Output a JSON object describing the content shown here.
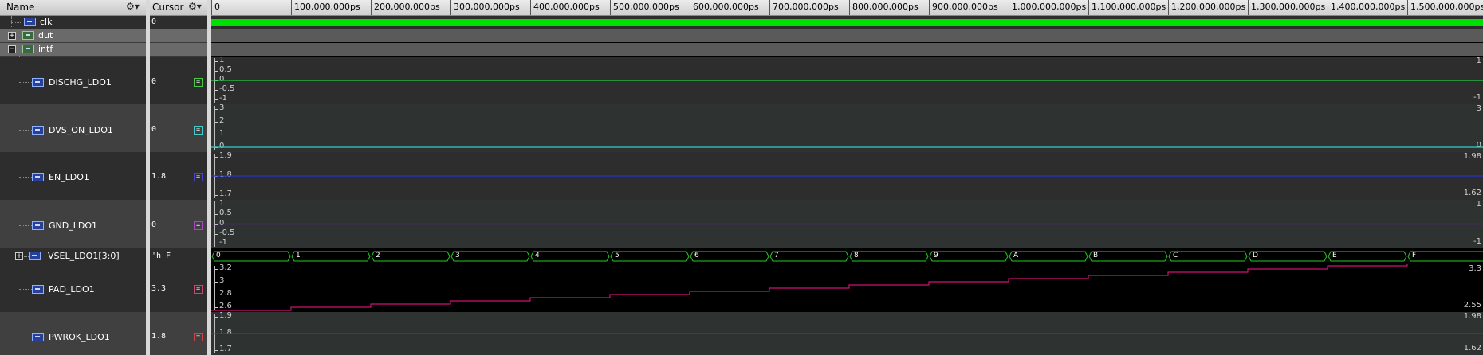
{
  "names_panel": {
    "title": "Name",
    "rows": [
      {
        "label": "clk"
      },
      {
        "label": "dut"
      },
      {
        "label": "intf"
      },
      {
        "label": "DISCHG_LDO1"
      },
      {
        "label": "DVS_ON_LDO1"
      },
      {
        "label": "EN_LDO1"
      },
      {
        "label": "GND_LDO1"
      },
      {
        "label": "VSEL_LDO1[3:0]"
      },
      {
        "label": "PAD_LDO1"
      },
      {
        "label": "PWROK_LDO1"
      }
    ]
  },
  "values_panel": {
    "title": "Cursor",
    "values": [
      "0",
      "",
      "",
      "0",
      "0",
      "1.8",
      "0",
      "'h F",
      "3.3",
      "1.8"
    ]
  },
  "ruler": {
    "labels": [
      "0",
      "100,000,000ps",
      "200,000,000ps",
      "300,000,000ps",
      "400,000,000ps",
      "500,000,000ps",
      "600,000,000ps",
      "700,000,000ps",
      "800,000,000ps",
      "900,000,000ps",
      "1,000,000,000ps",
      "1,100,000,000ps",
      "1,200,000,000ps",
      "1,300,000,000ps",
      "1,400,000,000ps",
      "1,500,000,000ps"
    ]
  },
  "waves": {
    "DISCHG_LDO1": {
      "ticks": [
        "1",
        "0.5",
        "0",
        "-0.5",
        "-1"
      ],
      "top": "1",
      "bottom": "-1",
      "value": 0,
      "color": "#22cc44"
    },
    "DVS_ON_LDO1": {
      "ticks": [
        "3",
        "2",
        "1",
        "0"
      ],
      "top": "3",
      "bottom": "0",
      "value": 0,
      "color": "#33cccc"
    },
    "EN_LDO1": {
      "ticks": [
        "1.9",
        "1.8",
        "1.7"
      ],
      "top": "1.98",
      "bottom": "1.62",
      "value": 1.8,
      "color": "#2233cc"
    },
    "GND_LDO1": {
      "ticks": [
        "1",
        "0.5",
        "0",
        "-0.5",
        "-1"
      ],
      "top": "1",
      "bottom": "-1",
      "value": 0,
      "color": "#8822cc"
    },
    "VSEL_LDO1": {
      "values": [
        "0",
        "1",
        "2",
        "3",
        "4",
        "5",
        "6",
        "7",
        "8",
        "9",
        "A",
        "B",
        "C",
        "D",
        "E",
        "F"
      ],
      "color": "#22cc22"
    },
    "PAD_LDO1": {
      "ticks": [
        "3.2",
        "3",
        "2.8",
        "2.6"
      ],
      "top": "3.3",
      "bottom": "2.55",
      "values": [
        2.55,
        2.6,
        2.65,
        2.7,
        2.75,
        2.8,
        2.85,
        2.9,
        2.95,
        3.0,
        3.05,
        3.1,
        3.15,
        3.2,
        3.25,
        3.3
      ],
      "color": "#cc1177"
    },
    "PWROK_LDO1": {
      "ticks": [
        "1.9",
        "1.8",
        "1.7"
      ],
      "top": "1.98",
      "bottom": "1.62",
      "value": 1.8,
      "color": "#cc1111"
    }
  }
}
